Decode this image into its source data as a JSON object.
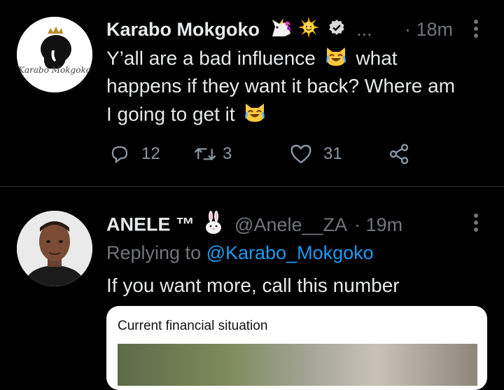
{
  "tweet1": {
    "name": "Karabo Mokgoko",
    "ellipsis": "...",
    "time": "· 18m",
    "text_line1a": "Y’all are a bad influence",
    "text_line1b": "what",
    "text_line2": "happens if they want it back? Where am",
    "text_line3": "I going to get it",
    "avatar_text": "Karabo Mokgoko",
    "replies": "12",
    "retweets": "3",
    "likes": "31"
  },
  "tweet2": {
    "name": "ANELE ™",
    "handle": "@Anele__ZA",
    "time": "· 19m",
    "replying_prefix": "Replying to",
    "replying_user": "@Karabo_Mokgoko",
    "text": "If you want more, call this number",
    "card_title": "Current financial situation"
  },
  "colors": {
    "background": "#000000",
    "text": "#e7e9ea",
    "muted": "#71767b",
    "link": "#1d9bf0"
  }
}
